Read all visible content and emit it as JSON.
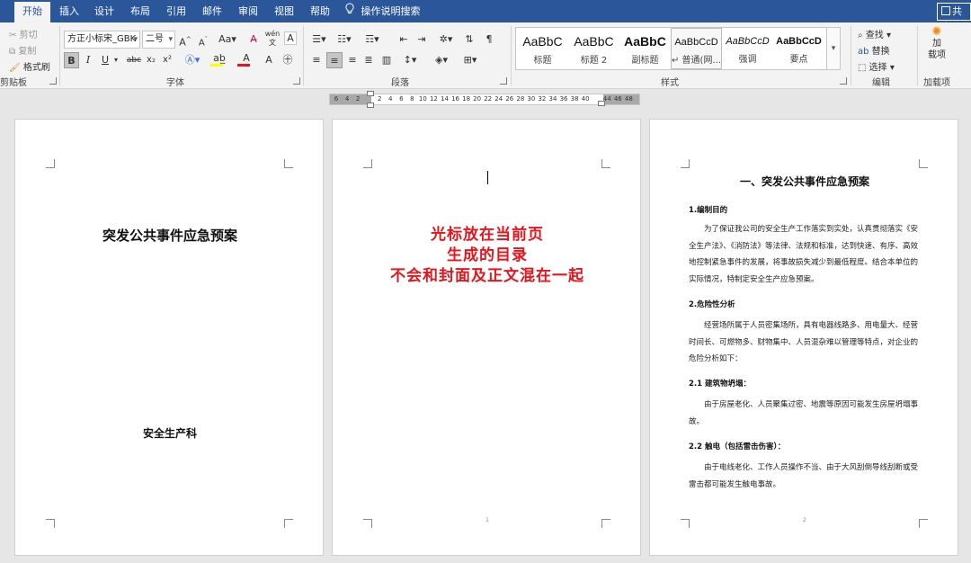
{
  "tabs": [
    "开始",
    "插入",
    "设计",
    "布局",
    "引用",
    "邮件",
    "审阅",
    "视图",
    "帮助"
  ],
  "active_tab": "开始",
  "tell_me": "操作说明搜索",
  "share_label": "共享",
  "clipboard": {
    "cut": "剪切",
    "copy": "复制",
    "format_painter": "格式刷",
    "label": "剪贴板"
  },
  "font": {
    "name": "方正小标宋_GBK",
    "size": "二号",
    "label": "字体",
    "bold": "B",
    "italic": "I",
    "underline": "U",
    "strike": "abc",
    "subscript": "x₂",
    "superscript": "x²"
  },
  "paragraph": {
    "label": "段落"
  },
  "styles": {
    "label": "样式",
    "items": [
      {
        "sample": "AaBbC",
        "name": "标题"
      },
      {
        "sample": "AaBbC",
        "name": "标题 2"
      },
      {
        "sample": "AaBbC",
        "name": "副标题"
      },
      {
        "sample": "AaBbCcD",
        "name": "↵ 普通(网..."
      },
      {
        "sample": "AaBbCcD",
        "name": "强调"
      },
      {
        "sample": "AaBbCcD",
        "name": "要点"
      }
    ]
  },
  "editing": {
    "find": "查找",
    "replace": "替换",
    "select": "选择",
    "label": "编辑"
  },
  "addins": {
    "button": "加\n载项",
    "label": "加载项"
  },
  "ruler": {
    "ticks": [
      "6",
      "4",
      "2",
      "",
      "2",
      "4",
      "6",
      "8",
      "10",
      "12",
      "14",
      "16",
      "18",
      "20",
      "22",
      "24",
      "26",
      "28",
      "30",
      "32",
      "34",
      "36",
      "38",
      "40",
      "",
      "44",
      "46",
      "48"
    ]
  },
  "page1": {
    "title": "突发公共事件应急预案",
    "department": "安全生产科"
  },
  "page2": {
    "lines": [
      "光标放在当前页",
      "生成的目录",
      "不会和封面及正文混在一起"
    ],
    "page_number": "1",
    "text_color": "#e8141b"
  },
  "page3": {
    "title": "一、突发公共事件应急预案",
    "page_number": "2",
    "sections": [
      {
        "heading": "1.编制目的",
        "text": "为了保证我公司的安全生产工作落实到实处，认真贯彻落实《安全生产法》、《消防法》等法律、法规和标准，达到快速、有序、高效地控制紧急事件的发展，将事故损失减少到最低程度。结合本单位的实际情况，特制定安全生产应急预案。"
      },
      {
        "heading": "2.危险性分析",
        "text": "经营场所属于人员密集场所，具有电器线路多、用电量大、经营时间长、可燃物多、财物集中、人员混杂难以管理等特点，对企业的危险分析如下："
      },
      {
        "heading": "2.1 建筑物坍塌：",
        "text": "由于房屋老化、人员聚集过密、地震等原因可能发生房屋坍塌事故。"
      },
      {
        "heading": "2.2 触电（包括雷击伤害）：",
        "text": "由于电线老化、工作人员操作不当、由于大风刮倒导线刮断或受雷击都可能发生触电事故。"
      }
    ]
  },
  "colors": {
    "ribbon_blue": "#2b579a",
    "accent_red": "#e8141b"
  },
  "icons": [
    "lightbulb-icon",
    "cut-icon",
    "copy-icon",
    "format-painter-icon",
    "search-icon",
    "replace-icon",
    "select-icon",
    "addin-icon"
  ]
}
